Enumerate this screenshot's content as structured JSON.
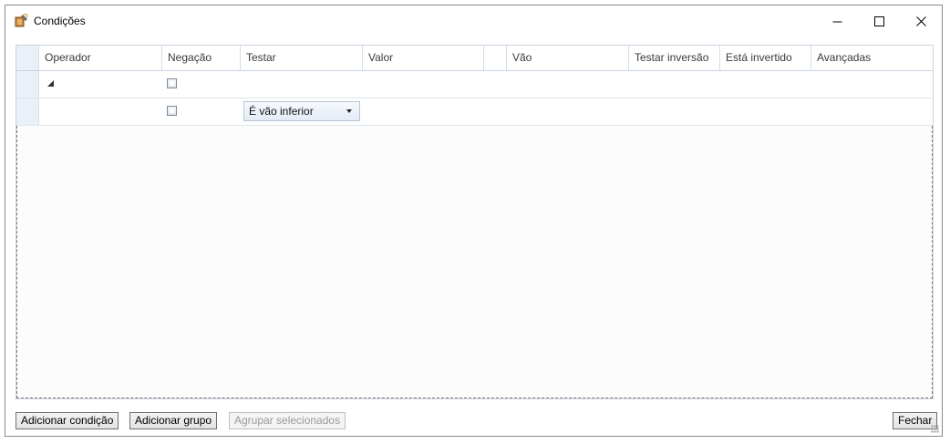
{
  "window": {
    "title": "Condições",
    "icon": "app-tool-icon",
    "controls": [
      "minimize-icon",
      "maximize-icon",
      "close-icon"
    ]
  },
  "grid": {
    "columns": [
      {
        "key": "operador",
        "label": "Operador"
      },
      {
        "key": "negacao",
        "label": "Negação"
      },
      {
        "key": "testar",
        "label": "Testar"
      },
      {
        "key": "valor",
        "label": "Valor"
      },
      {
        "key": "blank",
        "label": ""
      },
      {
        "key": "vao",
        "label": "Vão"
      },
      {
        "key": "testar_inversao",
        "label": "Testar inversão"
      },
      {
        "key": "esta_invertido",
        "label": "Está invertido"
      },
      {
        "key": "avancadas",
        "label": "Avançadas"
      }
    ],
    "rows": [
      {
        "type": "group",
        "expanded": true,
        "negacao": false
      },
      {
        "type": "condition",
        "negacao": false,
        "testar": "É vão inferior"
      }
    ]
  },
  "buttons": {
    "add_condition": "Adicionar condição",
    "add_group": "Adicionar grupo",
    "group_selected": "Agrupar selecionados",
    "close": "Fechar"
  },
  "colors": {
    "grid_border": "#c9d3de",
    "row_header": "#eaf0f7",
    "combo_bg": "#e3ebf6"
  }
}
